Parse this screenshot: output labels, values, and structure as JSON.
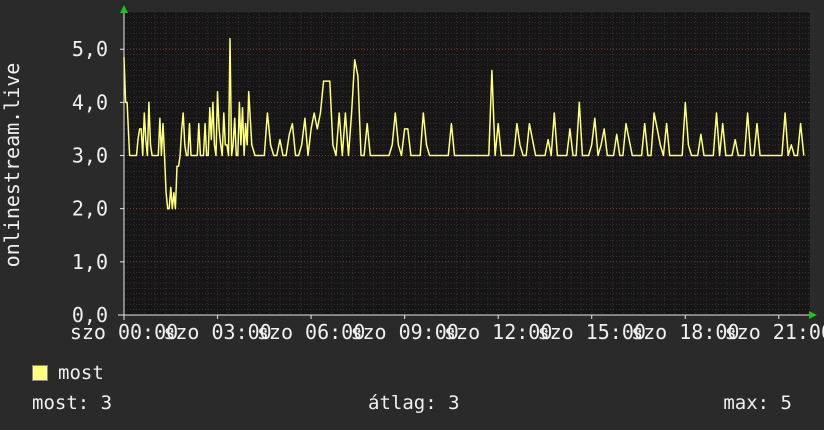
{
  "chart_data": {
    "type": "line",
    "ylabel": "onlinestream.live",
    "ylim": [
      0,
      5.7
    ],
    "yticks": [
      {
        "value": 0,
        "label": "0,0"
      },
      {
        "value": 1,
        "label": "1,0"
      },
      {
        "value": 2,
        "label": "2,0"
      },
      {
        "value": 3,
        "label": "3,0"
      },
      {
        "value": 4,
        "label": "4,0"
      },
      {
        "value": 5,
        "label": "5,0"
      }
    ],
    "xlim": [
      0,
      22
    ],
    "xticks": [
      {
        "value": 0,
        "label": "szo 00:00"
      },
      {
        "value": 3,
        "label": "szo 03:00"
      },
      {
        "value": 6,
        "label": "szo 06:00"
      },
      {
        "value": 9,
        "label": "szo 09:00"
      },
      {
        "value": 12,
        "label": "szo 12:00"
      },
      {
        "value": 15,
        "label": "szo 15:00"
      },
      {
        "value": 18,
        "label": "szo 18:00"
      },
      {
        "value": 21,
        "label": "szo 21:00"
      }
    ],
    "grid": true,
    "background": "#161616",
    "grid_color": "#3c2e2e",
    "axis_color": "#e8e8e8",
    "arrow_color": "#20c020",
    "series": [
      {
        "name": "most",
        "color": "#ffff80",
        "x": [
          0.0,
          0.05,
          0.1,
          0.18,
          0.2,
          0.25,
          0.3,
          0.35,
          0.4,
          0.45,
          0.5,
          0.55,
          0.6,
          0.65,
          0.7,
          0.75,
          0.8,
          0.85,
          0.9,
          0.95,
          1.0,
          1.05,
          1.1,
          1.15,
          1.2,
          1.25,
          1.3,
          1.35,
          1.4,
          1.45,
          1.5,
          1.55,
          1.6,
          1.65,
          1.7,
          1.75,
          1.8,
          1.85,
          1.9,
          1.95,
          2.0,
          2.05,
          2.1,
          2.15,
          2.2,
          2.25,
          2.3,
          2.35,
          2.4,
          2.45,
          2.5,
          2.55,
          2.6,
          2.65,
          2.7,
          2.75,
          2.8,
          2.85,
          2.9,
          2.95,
          3.0,
          3.05,
          3.1,
          3.15,
          3.2,
          3.25,
          3.3,
          3.35,
          3.4,
          3.45,
          3.5,
          3.55,
          3.6,
          3.65,
          3.7,
          3.75,
          3.8,
          3.85,
          3.9,
          3.95,
          4.0,
          4.1,
          4.2,
          4.3,
          4.4,
          4.5,
          4.6,
          4.7,
          4.8,
          4.9,
          5.0,
          5.1,
          5.2,
          5.3,
          5.4,
          5.5,
          5.6,
          5.7,
          5.8,
          5.9,
          6.0,
          6.1,
          6.2,
          6.3,
          6.4,
          6.5,
          6.6,
          6.7,
          6.8,
          6.9,
          7.0,
          7.1,
          7.2,
          7.3,
          7.4,
          7.5,
          7.6,
          7.7,
          7.8,
          7.9,
          8.0,
          8.1,
          8.2,
          8.3,
          8.4,
          8.5,
          8.6,
          8.7,
          8.8,
          8.9,
          9.0,
          9.1,
          9.2,
          9.3,
          9.4,
          9.5,
          9.6,
          9.7,
          9.8,
          9.9,
          10.0,
          10.1,
          10.2,
          10.3,
          10.4,
          10.5,
          10.6,
          10.7,
          10.8,
          10.9,
          11.0,
          11.1,
          11.2,
          11.3,
          11.4,
          11.5,
          11.6,
          11.7,
          11.8,
          11.9,
          12.0,
          12.1,
          12.2,
          12.3,
          12.4,
          12.5,
          12.6,
          12.7,
          12.8,
          12.9,
          13.0,
          13.1,
          13.2,
          13.3,
          13.4,
          13.5,
          13.6,
          13.7,
          13.8,
          13.9,
          14.0,
          14.1,
          14.2,
          14.3,
          14.4,
          14.5,
          14.6,
          14.7,
          14.8,
          14.9,
          15.0,
          15.1,
          15.2,
          15.3,
          15.4,
          15.5,
          15.6,
          15.7,
          15.8,
          15.9,
          16.0,
          16.1,
          16.2,
          16.3,
          16.4,
          16.5,
          16.6,
          16.7,
          16.8,
          16.9,
          17.0,
          17.1,
          17.2,
          17.3,
          17.4,
          17.5,
          17.6,
          17.7,
          17.8,
          17.9,
          18.0,
          18.1,
          18.2,
          18.3,
          18.4,
          18.5,
          18.6,
          18.7,
          18.8,
          18.9,
          19.0,
          19.1,
          19.2,
          19.3,
          19.4,
          19.5,
          19.6,
          19.7,
          19.8,
          19.9,
          20.0,
          20.1,
          20.2,
          20.3,
          20.4,
          20.5,
          20.6,
          20.7,
          20.8,
          20.9,
          21.0,
          21.1,
          21.2,
          21.3,
          21.4,
          21.5,
          21.6,
          21.7,
          21.8
        ],
        "values": [
          4.85,
          4.0,
          4.0,
          3.0,
          3.0,
          3.0,
          3.0,
          3.0,
          3.0,
          3.3,
          3.5,
          3.5,
          3.0,
          3.8,
          3.3,
          3.0,
          4.0,
          3.2,
          3.0,
          3.0,
          3.0,
          3.0,
          3.0,
          3.7,
          3.0,
          3.6,
          3.0,
          2.3,
          2.0,
          2.0,
          2.4,
          2.0,
          2.3,
          2.0,
          2.8,
          2.8,
          3.0,
          3.5,
          3.8,
          3.2,
          3.0,
          3.0,
          3.6,
          3.0,
          3.0,
          3.0,
          3.0,
          3.0,
          3.6,
          3.0,
          3.0,
          3.0,
          3.6,
          3.0,
          3.0,
          3.9,
          3.3,
          4.0,
          3.2,
          3.0,
          4.2,
          3.5,
          3.2,
          3.0,
          3.8,
          3.2,
          3.2,
          3.0,
          5.2,
          3.0,
          3.2,
          3.7,
          3.0,
          3.0,
          4.0,
          3.2,
          3.9,
          3.0,
          3.6,
          3.2,
          4.2,
          3.2,
          3.0,
          3.0,
          3.0,
          3.0,
          3.8,
          3.2,
          3.0,
          3.0,
          3.3,
          3.0,
          3.0,
          3.4,
          3.6,
          3.0,
          3.0,
          3.2,
          3.7,
          3.0,
          3.5,
          3.8,
          3.5,
          3.8,
          4.4,
          4.4,
          4.4,
          3.2,
          3.0,
          3.8,
          3.0,
          3.8,
          3.0,
          3.8,
          4.8,
          4.5,
          3.0,
          3.0,
          3.6,
          3.0,
          3.0,
          3.0,
          3.0,
          3.0,
          3.0,
          3.0,
          3.2,
          3.8,
          3.2,
          3.0,
          3.5,
          3.5,
          3.0,
          3.0,
          3.0,
          3.0,
          3.8,
          3.2,
          3.0,
          3.0,
          3.0,
          3.0,
          3.0,
          3.0,
          3.0,
          3.6,
          3.0,
          3.0,
          3.0,
          3.0,
          3.0,
          3.0,
          3.0,
          3.0,
          3.0,
          3.0,
          3.0,
          3.0,
          4.6,
          3.0,
          3.6,
          3.0,
          3.0,
          3.0,
          3.0,
          3.0,
          3.6,
          3.2,
          3.0,
          3.0,
          3.6,
          3.3,
          3.0,
          3.0,
          3.0,
          3.0,
          3.3,
          3.0,
          3.8,
          3.0,
          3.0,
          3.0,
          3.0,
          3.5,
          3.0,
          3.0,
          4.0,
          3.0,
          3.0,
          3.0,
          3.2,
          3.7,
          3.0,
          3.2,
          3.5,
          3.0,
          3.0,
          3.0,
          3.4,
          3.0,
          3.0,
          3.6,
          3.3,
          3.0,
          3.0,
          3.0,
          3.0,
          3.6,
          3.0,
          3.0,
          3.8,
          3.5,
          3.2,
          3.0,
          3.6,
          3.0,
          3.0,
          3.0,
          3.0,
          3.0,
          4.0,
          3.2,
          3.0,
          3.0,
          3.0,
          3.4,
          3.0,
          3.0,
          3.0,
          3.0,
          3.8,
          3.0,
          3.6,
          3.0,
          3.0,
          3.0,
          3.3,
          3.0,
          3.0,
          3.0,
          3.8,
          3.0,
          3.0,
          3.6,
          3.0,
          3.0,
          3.0,
          3.0,
          3.0,
          3.0,
          3.0,
          3.0,
          3.8,
          3.0,
          3.2,
          3.0,
          3.0,
          3.6,
          3.0
        ]
      }
    ]
  },
  "legend": {
    "label": "most",
    "swatch_color": "#ffff80"
  },
  "stats": {
    "current": "most: 3",
    "average": "átlag: 3",
    "max": "max: 5"
  }
}
